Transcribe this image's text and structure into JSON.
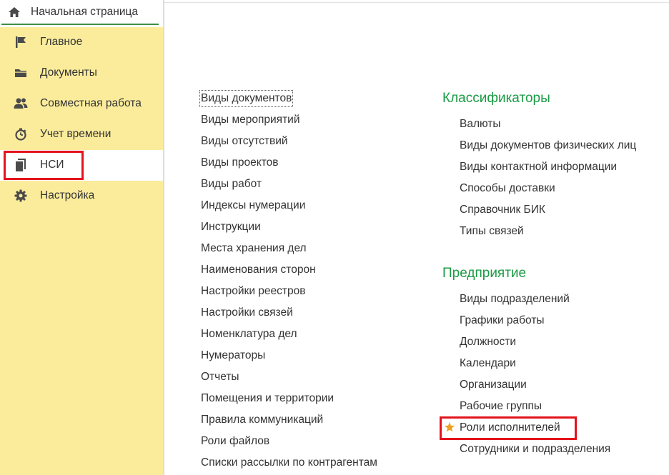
{
  "home_tab": {
    "label": "Начальная страница",
    "icon": "home-icon"
  },
  "sidebar": {
    "items": [
      {
        "label": "Главное",
        "icon": "flag-icon"
      },
      {
        "label": "Документы",
        "icon": "folder-icon"
      },
      {
        "label": "Совместная работа",
        "icon": "users-icon"
      },
      {
        "label": "Учет времени",
        "icon": "stopwatch-icon"
      },
      {
        "label": "НСИ",
        "icon": "copy-documents-icon",
        "active": true
      },
      {
        "label": "Настройка",
        "icon": "gear-icon"
      }
    ]
  },
  "left_links": [
    "Виды документов",
    "Виды мероприятий",
    "Виды отсутствий",
    "Виды проектов",
    "Виды работ",
    "Индексы нумерации",
    "Инструкции",
    "Места хранения дел",
    "Наименования сторон",
    "Настройки реестров",
    "Настройки связей",
    "Номенклатура дел",
    "Нумераторы",
    "Отчеты",
    "Помещения и территории",
    "Правила коммуникаций",
    "Роли файлов",
    "Списки рассылки по контрагентам"
  ],
  "sections": [
    {
      "title": "Классификаторы",
      "links": [
        "Валюты",
        "Виды документов физических лиц",
        "Виды контактной информации",
        "Способы доставки",
        "Справочник БИК",
        "Типы связей"
      ]
    },
    {
      "title": "Предприятие",
      "links": [
        "Виды подразделений",
        "Графики работы",
        "Должности",
        "Календари",
        "Организации",
        "Рабочие группы",
        "Роли исполнителей",
        "Сотрудники и подразделения"
      ]
    }
  ],
  "colors": {
    "sidebar_bg": "#fbec9c",
    "section_title": "#1a9b44",
    "highlight": "#e3131c",
    "favorite_star": "#f0a020",
    "icon": "#4a4a4a"
  }
}
